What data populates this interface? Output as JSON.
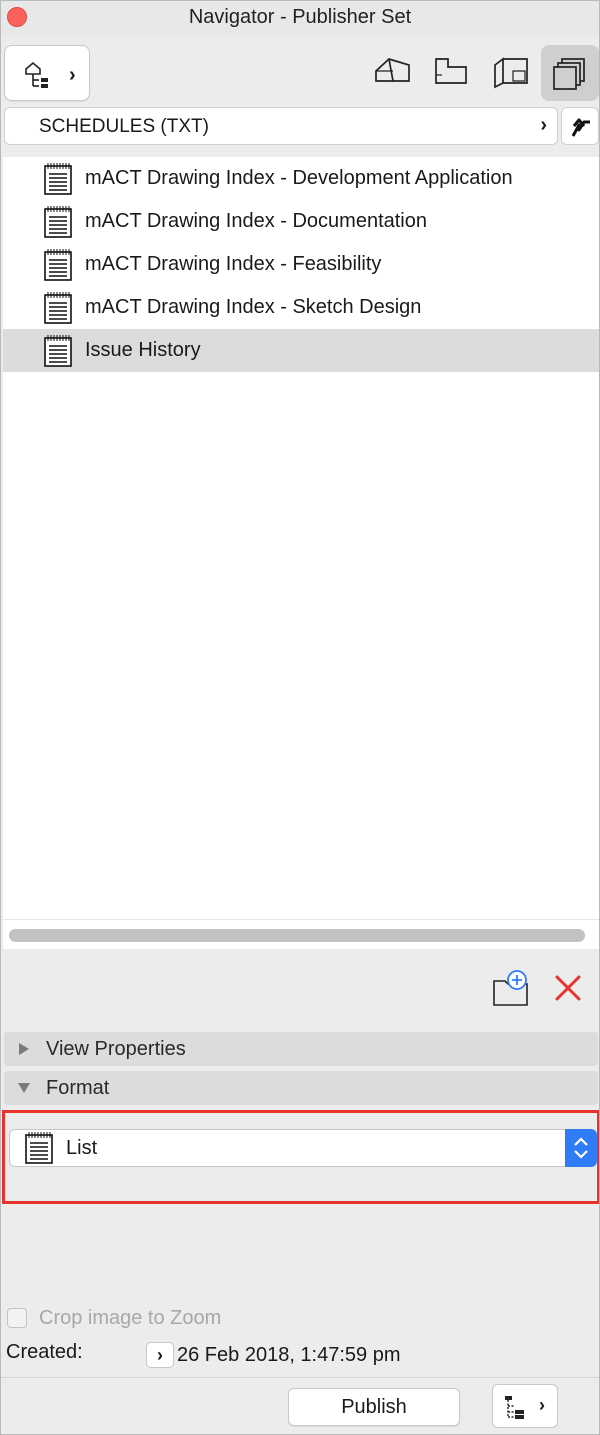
{
  "window": {
    "title": "Navigator - Publisher Set"
  },
  "toolbar": {
    "map_switch_icon": "tree-map-icon",
    "map_switch_chevron": "›",
    "buttons": [
      {
        "name": "project-map",
        "icon": "house-icon"
      },
      {
        "name": "view-map",
        "icon": "floor-plan-icon"
      },
      {
        "name": "layout-book",
        "icon": "layout-book-icon"
      },
      {
        "name": "publisher-sets",
        "icon": "publisher-sets-icon",
        "active": true
      }
    ]
  },
  "path": {
    "label": "SCHEDULES (TXT)",
    "chevron": "›",
    "up_icon": "up-arrow-icon"
  },
  "list": {
    "items": [
      {
        "label": "mACT Drawing Index - Development Application",
        "icon": "schedule-doc-icon",
        "selected": false
      },
      {
        "label": "mACT Drawing Index - Documentation",
        "icon": "schedule-doc-icon",
        "selected": false
      },
      {
        "label": "mACT Drawing Index - Feasibility",
        "icon": "schedule-doc-icon",
        "selected": false
      },
      {
        "label": "mACT Drawing Index - Sketch Design",
        "icon": "schedule-doc-icon",
        "selected": false
      },
      {
        "label": "Issue History",
        "icon": "schedule-doc-icon",
        "selected": true
      }
    ]
  },
  "actions": {
    "new_folder_icon": "new-folder-icon",
    "delete_icon": "delete-x-icon",
    "delete_color": "#e8322d"
  },
  "panels": {
    "view_properties": {
      "label": "View Properties",
      "expanded": false
    },
    "format": {
      "label": "Format",
      "expanded": true
    }
  },
  "format": {
    "selected_value": "List",
    "highlight_color": "#e8322d",
    "stepper_color": "#2f7cf6"
  },
  "options": {
    "crop_label": "Crop image to Zoom",
    "crop_checked": false,
    "created_label": "Created:",
    "created_value": "26 Feb 2018, 1:47:59 pm",
    "created_chevron": "›"
  },
  "footer": {
    "publish_label": "Publish",
    "organizer_icon": "organizer-tree-icon",
    "organizer_chevron": "›"
  }
}
